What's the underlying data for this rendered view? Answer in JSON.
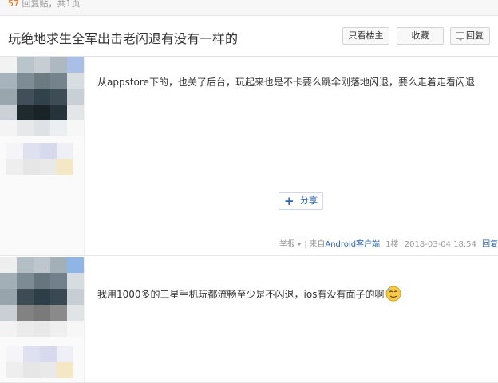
{
  "topbar": {
    "reply_count": "57",
    "reply_text": " 回复贴，共1页"
  },
  "thread": {
    "title": "玩绝地求生全军出击老闪退有没有一样的",
    "buttons": {
      "only_op": "只看楼主",
      "favorite": "收藏",
      "reply": "回复"
    }
  },
  "posts": [
    {
      "content": "从appstore下的，也关了后台，玩起来也是不卡要么跳伞刚落地闪退，要么走着走看闪退",
      "share_label": "分享",
      "meta": {
        "report": "举报",
        "client": "Android客户端",
        "client_prefix": "来自",
        "floor": "1楼",
        "time": "2018-03-04 18:54",
        "reply": "回复"
      }
    },
    {
      "content": "我用1000多的三星手机玩都流畅至少是不闪退，ios有没有面子的啊",
      "emoji": "sweat-smile-emoji"
    }
  ],
  "colors": {
    "link": "#2d64b3",
    "count": "#ff6600",
    "muted": "#999999"
  }
}
